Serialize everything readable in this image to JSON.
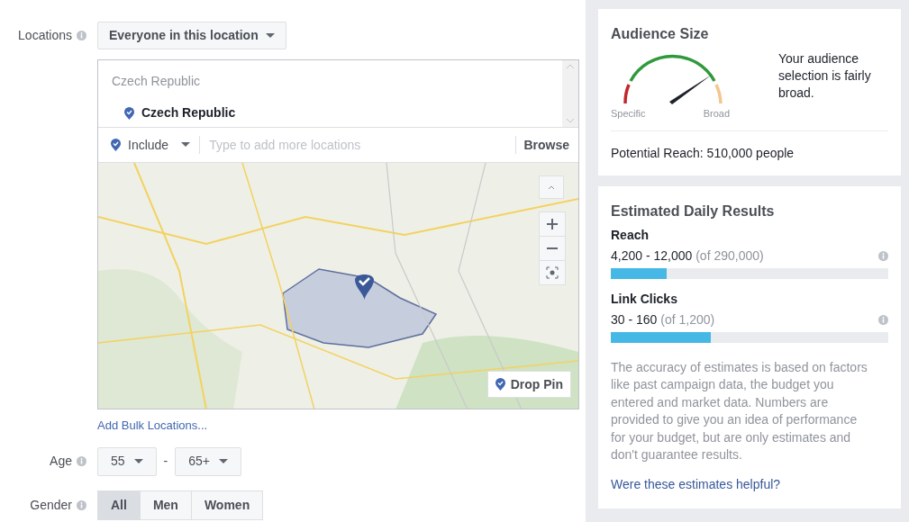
{
  "locations": {
    "label": "Locations",
    "targeting": "Everyone in this location",
    "search": {
      "header": "Czech Republic",
      "items": [
        {
          "name": "Czech Republic"
        }
      ],
      "include": "Include",
      "placeholder": "Type to add more locations",
      "browse": "Browse"
    },
    "map": {
      "kind": "picture",
      "drop_pin": "Drop Pin"
    },
    "bulk_link": "Add Bulk Locations..."
  },
  "age": {
    "label": "Age",
    "from": "55",
    "separator": "-",
    "to": "65+"
  },
  "gender": {
    "label": "Gender",
    "options": [
      {
        "label": "All",
        "selected": true
      },
      {
        "label": "Men",
        "selected": false
      },
      {
        "label": "Women",
        "selected": false
      }
    ]
  },
  "audience_size": {
    "title": "Audience Size",
    "gauge_low": "Specific",
    "gauge_high": "Broad",
    "description": "Your audience selection is fairly broad.",
    "potential_reach": "Potential Reach: 510,000 people"
  },
  "daily_results": {
    "title": "Estimated Daily Results",
    "metrics": [
      {
        "label": "Reach",
        "range": "4,200 - 12,000",
        "total": "(of 290,000)",
        "level": 0.2
      },
      {
        "label": "Link Clicks",
        "range": "30 - 160",
        "total": "(of 1,200)",
        "level": 0.36
      }
    ],
    "disclaimer": "The accuracy of estimates is based on factors like past campaign data, the budget you entered and market data. Numbers are provided to give you an idea of performance for your budget, but are only estimates and don't guarantee results.",
    "helpful_link": "Were these estimates helpful?"
  }
}
